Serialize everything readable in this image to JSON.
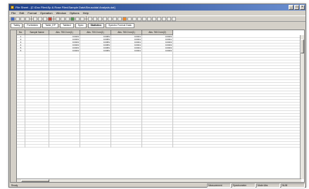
{
  "window": {
    "title": "File Sheet - [C:\\Doc Files\\Sp & Rose Files\\Sample Data\\Sinusoidal Analysis.dat]"
  },
  "menu": [
    "File",
    "Edit",
    "Format",
    "Operation",
    "Window",
    "Options",
    "Help"
  ],
  "tabs": [
    "Tabby",
    "Forbidden",
    "Table_EP",
    "Tabbed",
    "Spec",
    "Statistics",
    "Spectro Format Data"
  ],
  "table": {
    "headers": [
      "No.",
      "Sample Name",
      "Abs. 750.0 nm(1)",
      "Abs. 700.0 nm(1)",
      "Abs. 760.0 nm(1)",
      "Abs. 760.0 nm(2)"
    ],
    "rows": [
      [
        "1",
        "",
        "0.0043",
        "0.0081",
        "0.0041",
        "0.0043"
      ],
      [
        "2",
        "",
        "0.0043",
        "0.0081",
        "0.0041",
        "0.0041"
      ],
      [
        "3",
        "",
        "0.0043",
        "0.0081",
        "0.0041",
        "0.0043"
      ],
      [
        "4",
        "",
        "0.0043",
        "0.0081",
        "0.0041",
        "0.0043"
      ],
      [
        "5",
        "",
        "0.0043",
        "0.0081",
        "0.0041",
        "0.0043"
      ],
      [
        "6",
        "",
        "0.0043",
        "0.0081",
        "0.0041",
        "0.0043"
      ]
    ]
  },
  "status": {
    "left": "Ready",
    "segments": [
      "Measurement",
      "Spectrometer",
      "Mode:Abs",
      "NUM"
    ]
  }
}
